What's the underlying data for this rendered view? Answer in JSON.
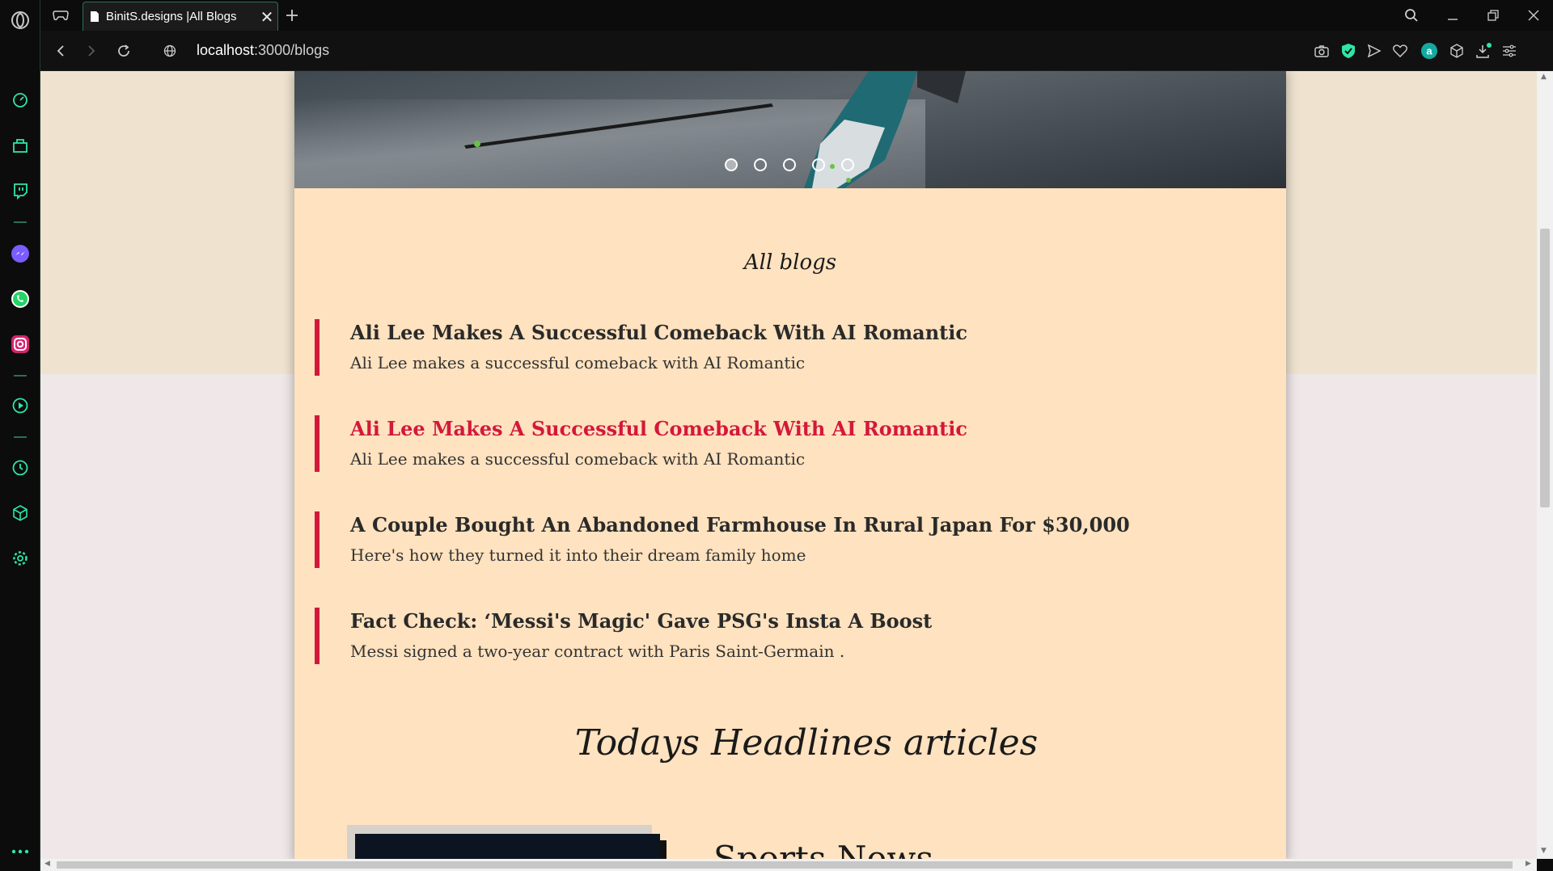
{
  "browser": {
    "tab": {
      "title": "BinitS.designs |All Blogs"
    },
    "url": {
      "host": "localhost",
      "path": ":3000/blogs"
    }
  },
  "sidebar": {
    "items": [
      {
        "name": "opera-logo-icon"
      },
      {
        "name": "speed-dial-icon"
      },
      {
        "name": "gx-corner-icon"
      },
      {
        "name": "twitch-icon"
      },
      {
        "name": "messenger-icon"
      },
      {
        "name": "whatsapp-icon"
      },
      {
        "name": "instagram-icon"
      },
      {
        "name": "player-icon"
      },
      {
        "name": "history-icon"
      },
      {
        "name": "extensions-icon"
      },
      {
        "name": "settings-icon"
      },
      {
        "name": "more-icon"
      }
    ]
  },
  "page": {
    "carousel": {
      "slide_count": 5,
      "active_index": 0
    },
    "all_blogs_title": "All blogs",
    "blogs": [
      {
        "title": "Ali Lee Makes A Successful Comeback With AI Romantic",
        "description": "Ali Lee makes a successful comeback with AI Romantic",
        "highlighted": false
      },
      {
        "title": "Ali Lee Makes A Successful Comeback With AI Romantic",
        "description": "Ali Lee makes a successful comeback with AI Romantic",
        "highlighted": true
      },
      {
        "title": "A Couple Bought An Abandoned Farmhouse In Rural Japan For $30,000",
        "description": "Here's how they turned it into their dream family home",
        "highlighted": false
      },
      {
        "title": "Fact Check: ‘Messi's Magic' Gave PSG's Insta A Boost",
        "description": "Messi signed a two-year contract with Paris Saint-Germain .",
        "highlighted": false
      }
    ],
    "headlines_title": "Todays Headlines articles",
    "article_heading": "Sports News"
  },
  "colors": {
    "accent_red": "#d4183a",
    "card_bg": "#ffe2bf",
    "gx_green": "#2ee6a8"
  }
}
